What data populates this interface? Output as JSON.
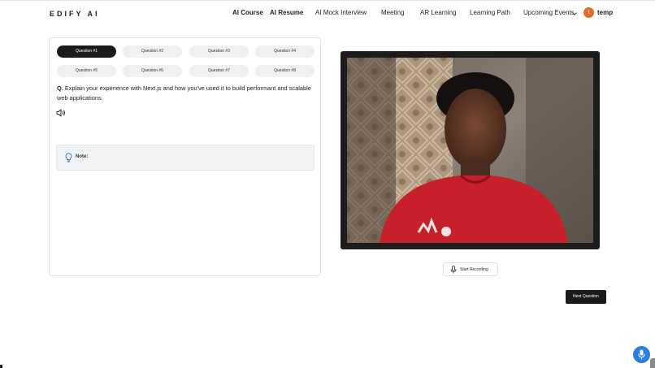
{
  "header": {
    "logo": "EDIFY AI",
    "nav": [
      {
        "label": "AI Course"
      },
      {
        "label": "AI Resume"
      },
      {
        "label": "AI Mock Interview"
      },
      {
        "label": "Meeting"
      },
      {
        "label": "AR Learning"
      },
      {
        "label": "Learning Path"
      },
      {
        "label": "Upcoming Events"
      }
    ],
    "avatar_initial": "t",
    "username": "temp"
  },
  "questions": {
    "tabs": [
      {
        "label": "Question #1",
        "active": true
      },
      {
        "label": "Question #2",
        "active": false
      },
      {
        "label": "Question #3",
        "active": false
      },
      {
        "label": "Question #4",
        "active": false
      },
      {
        "label": "Question #5",
        "active": false
      },
      {
        "label": "Question #6",
        "active": false
      },
      {
        "label": "Question #7",
        "active": false
      },
      {
        "label": "Question #8",
        "active": false
      }
    ],
    "prefix": "Q.",
    "text": "Explain your experience with Next.js and how you've used it to build performant and scalable web applications.",
    "note_label": "Note:"
  },
  "recording": {
    "start_label": "Start Recording"
  },
  "actions": {
    "next_label": "Next Question"
  },
  "colors": {
    "active_tab": "#1b1b1b",
    "avatar": "#e9692c",
    "fab": "#2a7de1",
    "note_bg": "#eef3f8"
  },
  "icons": [
    "speaker-icon",
    "lightbulb-icon",
    "microphone-icon",
    "chevron-down-icon",
    "voice-assistant-icon"
  ]
}
